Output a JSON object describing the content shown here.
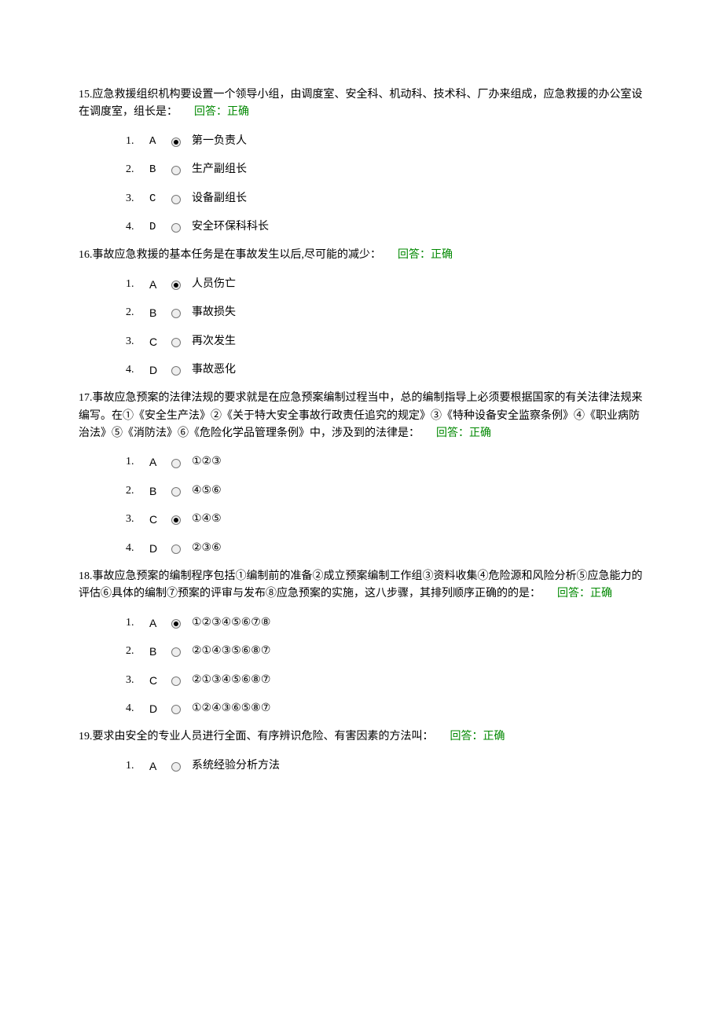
{
  "feedback_label": "回答：正确",
  "questions": [
    {
      "num": "15.",
      "text": "应急救援组织机构要设置一个领导小组，由调度室、安全科、机动科、技术科、厂办来组成，应急救援的办公室设在调度室，组长是：",
      "feedback_inline": false,
      "letter_class": "mono",
      "selected": 0,
      "opts": [
        {
          "idx": "1.",
          "L": "A",
          "t": "第一负责人"
        },
        {
          "idx": "2.",
          "L": "B",
          "t": "生产副组长"
        },
        {
          "idx": "3.",
          "L": "C",
          "t": "设备副组长"
        },
        {
          "idx": "4.",
          "L": "D",
          "t": "安全环保科科长"
        }
      ]
    },
    {
      "num": "16.",
      "text": "事故应急救援的基本任务是在事故发生以后,尽可能的减少：",
      "feedback_inline": true,
      "letter_class": "sans",
      "selected": 0,
      "opts": [
        {
          "idx": "1.",
          "L": "A",
          "t": "人员伤亡"
        },
        {
          "idx": "2.",
          "L": "B",
          "t": "事故损失"
        },
        {
          "idx": "3.",
          "L": "C",
          "t": "再次发生"
        },
        {
          "idx": "4.",
          "L": "D",
          "t": "事故恶化"
        }
      ]
    },
    {
      "num": "17.",
      "text": "事故应急预案的法律法规的要求就是在应急预案编制过程当中，总的编制指导上必须要根据国家的有关法律法规来编写。在①《安全生产法》②《关于特大安全事故行政责任追究的规定》③《特种设备安全监察条例》④《职业病防治法》⑤《消防法》⑥《危险化学品管理条例》中，涉及到的法律是：",
      "feedback_inline": true,
      "letter_class": "sans",
      "selected": 2,
      "opts": [
        {
          "idx": "1.",
          "L": "A",
          "t": "①②③"
        },
        {
          "idx": "2.",
          "L": "B",
          "t": "④⑤⑥"
        },
        {
          "idx": "3.",
          "L": "C",
          "t": "①④⑤"
        },
        {
          "idx": "4.",
          "L": "D",
          "t": "②③⑥"
        }
      ]
    },
    {
      "num": "18.",
      "text": "事故应急预案的编制程序包括①编制前的准备②成立预案编制工作组③资料收集④危险源和风险分析⑤应急能力的评估⑥具体的编制⑦预案的评审与发布⑧应急预案的实施，这八步骤，其排列顺序正确的的是：",
      "feedback_inline": true,
      "letter_class": "sans",
      "selected": 0,
      "opts": [
        {
          "idx": "1.",
          "L": "A",
          "t": "①②③④⑤⑥⑦⑧"
        },
        {
          "idx": "2.",
          "L": "B",
          "t": "②①④③⑤⑥⑧⑦"
        },
        {
          "idx": "3.",
          "L": "C",
          "t": "②①③④⑤⑥⑧⑦"
        },
        {
          "idx": "4.",
          "L": "D",
          "t": "①②④③⑥⑤⑧⑦"
        }
      ]
    },
    {
      "num": "19.",
      "text": "要求由安全的专业人员进行全面、有序辨识危险、有害因素的方法叫：",
      "feedback_inline": true,
      "letter_class": "sans",
      "selected": -1,
      "opts": [
        {
          "idx": "1.",
          "L": "A",
          "t": "系统经验分析方法"
        }
      ]
    }
  ]
}
